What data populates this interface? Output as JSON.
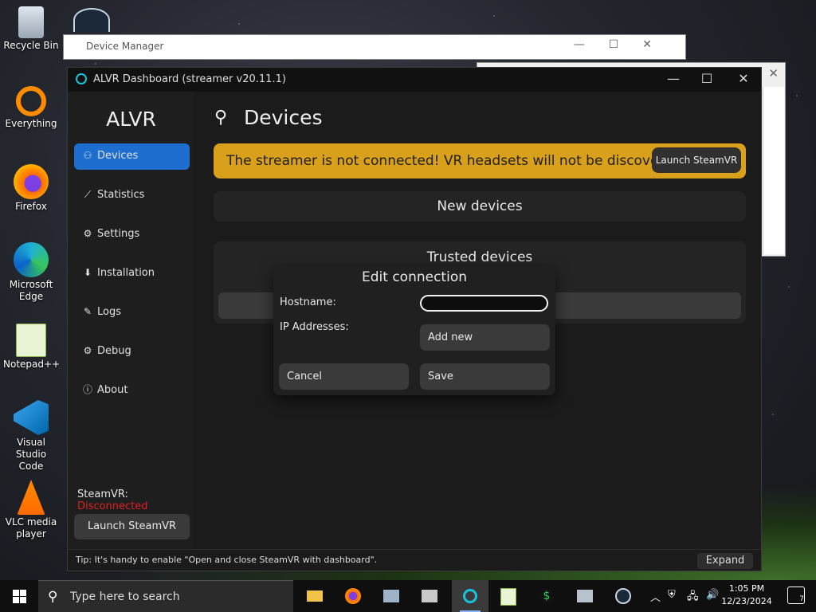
{
  "desktop": {
    "icons": [
      {
        "label": "Recycle Bin",
        "icon": "recycle-bin-icon"
      },
      {
        "label": "Everything",
        "icon": "everything-search-icon"
      },
      {
        "label": "Firefox",
        "icon": "firefox-icon"
      },
      {
        "label": "Microsoft Edge",
        "icon": "edge-icon"
      },
      {
        "label": "Notepad++",
        "icon": "notepadpp-icon"
      },
      {
        "label": "Visual Studio Code",
        "icon": "vscode-icon"
      },
      {
        "label": "VLC media player",
        "icon": "vlc-icon"
      }
    ],
    "steam_icon": "steam-icon"
  },
  "background_window": {
    "title": "Device Manager"
  },
  "window": {
    "title": "ALVR Dashboard (streamer v20.11.1)",
    "controls": {
      "minimize": "—",
      "maximize": "☐",
      "close": "✕"
    }
  },
  "sidebar": {
    "brand": "ALVR",
    "items": [
      {
        "label": "Devices",
        "icon": "⚇",
        "active": true
      },
      {
        "label": "Statistics",
        "icon": "📈"
      },
      {
        "label": "Settings",
        "icon": "⚙"
      },
      {
        "label": "Installation",
        "icon": "⬇"
      },
      {
        "label": "Logs",
        "icon": "✎"
      },
      {
        "label": "Debug",
        "icon": "⚙"
      },
      {
        "label": "About",
        "icon": "ⓘ"
      }
    ],
    "steamvr_label": "SteamVR:",
    "steamvr_status": "Disconnected",
    "launch_button": "Launch SteamVR"
  },
  "main": {
    "page_title": "Devices",
    "page_icon": "⚲",
    "banner": {
      "message": "The streamer is not connected! VR headsets will not be discovered",
      "button": "Launch SteamVR",
      "color": "#d9a01c"
    },
    "new_devices_title": "New devices",
    "trusted_devices_title": "Trusted devices"
  },
  "dialog": {
    "title": "Edit connection",
    "hostname_label": "Hostname:",
    "hostname_value": "",
    "ip_label": "IP Addresses:",
    "add_new": "Add new",
    "cancel": "Cancel",
    "save": "Save"
  },
  "footer": {
    "tip": "Tip: It's handy to enable \"Open and close SteamVR with dashboard\".",
    "expand": "Expand"
  },
  "taskbar": {
    "search_placeholder": "Type here to search",
    "time": "1:05 PM",
    "date": "12/23/2024",
    "notifications": "7",
    "accent": "#1e6ed0"
  }
}
